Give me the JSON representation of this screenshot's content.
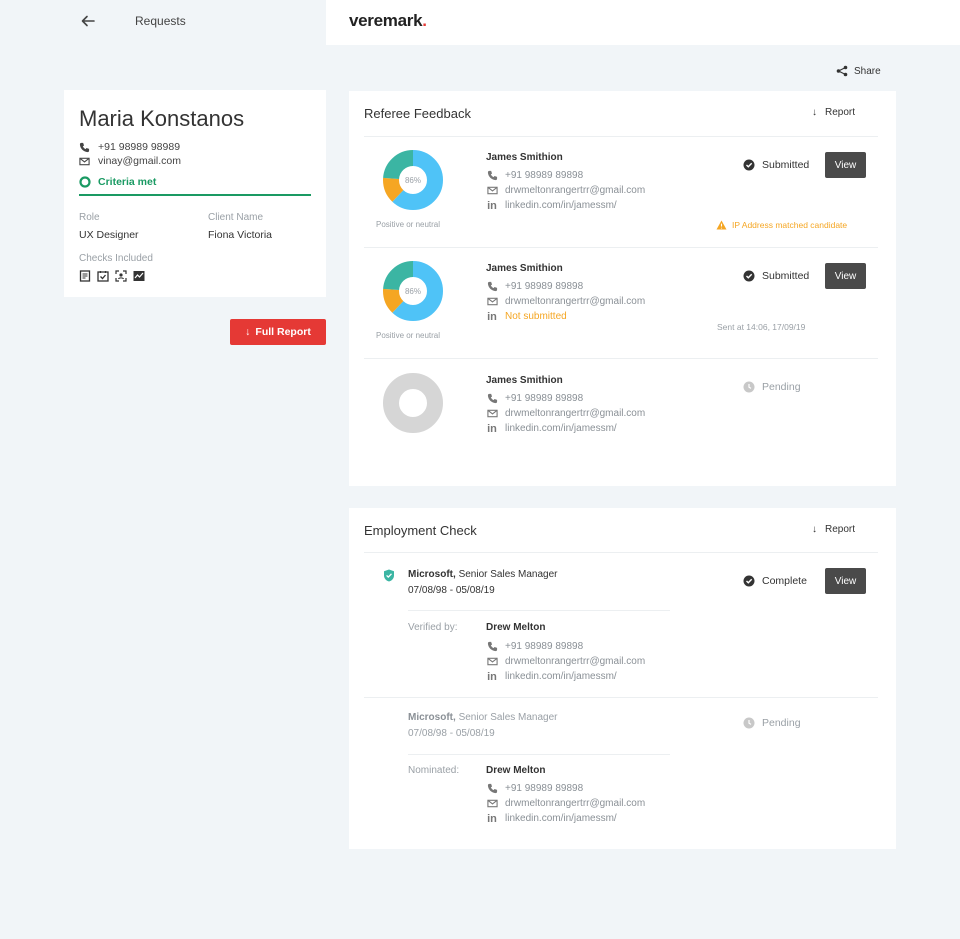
{
  "header": {
    "back_title": "Requests",
    "logo_text": "veremark",
    "logo_dot": "."
  },
  "share_label": "Share",
  "candidate": {
    "name": "Maria Konstanos",
    "phone": "+91 98989 98989",
    "email": "vinay@gmail.com",
    "criteria": "Criteria met",
    "role_label": "Role",
    "role": "UX Designer",
    "client_label": "Client Name",
    "client": "Fiona Victoria",
    "checks_label": "Checks Included"
  },
  "full_report_label": "Full Report",
  "referee_panel": {
    "title": "Referee Feedback",
    "report_label": "Report",
    "referees": [
      {
        "name": "James Smithion",
        "phone": "+91 98989 89898",
        "email": "drwmeltonrangertrr@gmail.com",
        "linkedin": "linkedin.com/in/jamessm/",
        "status": "Submitted",
        "view": "View",
        "donut_pct": "86%",
        "caption": "Positive or neutral",
        "note": "IP Address matched candidate"
      },
      {
        "name": "James Smithion",
        "phone": "+91 98989 89898",
        "email": "drwmeltonrangertrr@gmail.com",
        "linkedin": "Not submitted",
        "status": "Submitted",
        "view": "View",
        "donut_pct": "86%",
        "caption": "Positive or neutral",
        "note": "Sent at 14:06, 17/09/19"
      },
      {
        "name": "James Smithion",
        "phone": "+91 98989 89898",
        "email": "drwmeltonrangertrr@gmail.com",
        "linkedin": "linkedin.com/in/jamessm/",
        "status": "Pending"
      }
    ]
  },
  "employment_panel": {
    "title": "Employment Check",
    "report_label": "Report",
    "entries": [
      {
        "company": "Microsoft,",
        "position": "Senior Sales Manager",
        "dates": "07/08/98 - 05/08/19",
        "status": "Complete",
        "view": "View",
        "verifier_label": "Verified by:",
        "name": "Drew Melton",
        "phone": "+91 98989 89898",
        "email": "drwmeltonrangertrr@gmail.com",
        "linkedin": "linkedin.com/in/jamessm/"
      },
      {
        "company": "Microsoft,",
        "position": "Senior Sales Manager",
        "dates": "07/08/98 - 05/08/19",
        "status": "Pending",
        "verifier_label": "Nominated:",
        "name": "Drew Melton",
        "phone": "+91 98989 89898",
        "email": "drwmeltonrangertrr@gmail.com",
        "linkedin": "linkedin.com/in/jamessm/"
      }
    ]
  },
  "colors": {
    "accent_red": "#e53935",
    "green": "#1a9a63",
    "teal": "#3bb5a3",
    "blue": "#4fc3f7",
    "orange": "#f5a623",
    "dark_button": "#4a4a4a"
  },
  "donut_segments": {
    "blue": 0.62,
    "orange": 0.14,
    "teal": 0.24
  }
}
